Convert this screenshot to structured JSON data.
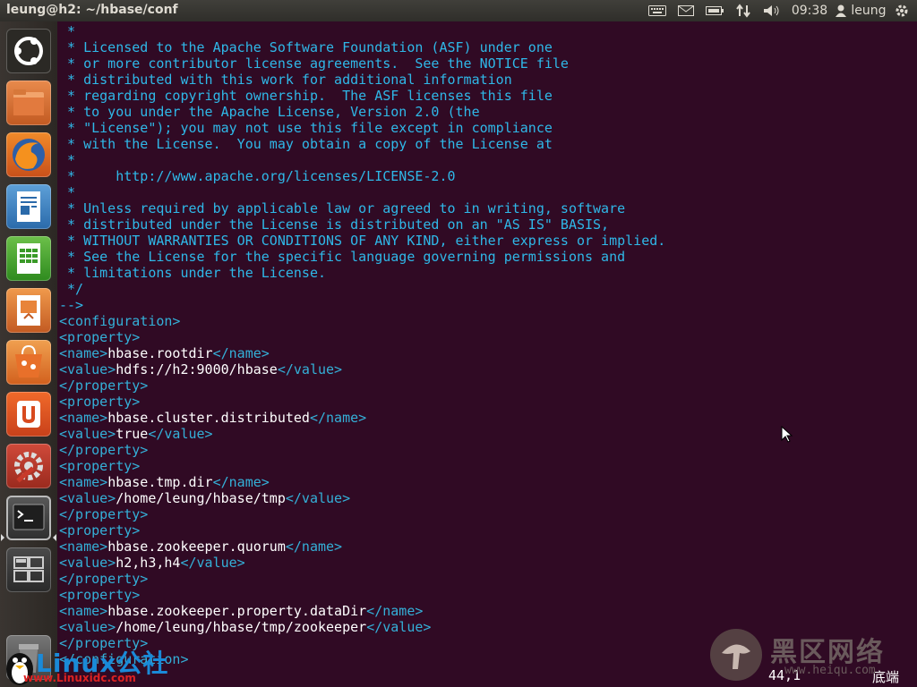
{
  "window_title": "leung@h2: ~/hbase/conf",
  "panel": {
    "clock": "09:38",
    "user": "leung",
    "icons": [
      "keyboard-icon",
      "mail-icon",
      "battery-icon",
      "network-icon",
      "volume-icon",
      "user-icon",
      "gear-icon"
    ]
  },
  "launcher": {
    "items": [
      {
        "name": "ubuntu-dash-icon"
      },
      {
        "name": "files-icon"
      },
      {
        "name": "firefox-icon"
      },
      {
        "name": "writer-icon"
      },
      {
        "name": "calc-icon"
      },
      {
        "name": "impress-icon"
      },
      {
        "name": "software-center-icon"
      },
      {
        "name": "ubuntu-one-icon"
      },
      {
        "name": "system-settings-icon"
      },
      {
        "name": "terminal-icon"
      },
      {
        "name": "workspace-switcher-icon"
      },
      {
        "name": "trash-icon"
      }
    ]
  },
  "terminal": {
    "lines": [
      " *",
      " * Licensed to the Apache Software Foundation (ASF) under one",
      " * or more contributor license agreements.  See the NOTICE file",
      " * distributed with this work for additional information",
      " * regarding copyright ownership.  The ASF licenses this file",
      " * to you under the Apache License, Version 2.0 (the",
      " * \"License\"); you may not use this file except in compliance",
      " * with the License.  You may obtain a copy of the License at",
      " *",
      " *     http://www.apache.org/licenses/LICENSE-2.0",
      " *",
      " * Unless required by applicable law or agreed to in writing, software",
      " * distributed under the License is distributed on an \"AS IS\" BASIS,",
      " * WITHOUT WARRANTIES OR CONDITIONS OF ANY KIND, either express or implied.",
      " * See the License for the specific language governing permissions and",
      " * limitations under the License.",
      " */",
      "-->",
      "<configuration>",
      "<property>",
      "<name>hbase.rootdir</name>",
      "<value>hdfs://h2:9000/hbase</value>",
      "</property>",
      "<property>",
      "<name>hbase.cluster.distributed</name>",
      "<value>true</value>",
      "</property>",
      "<property>",
      "<name>hbase.tmp.dir</name>",
      "<value>/home/leung/hbase/tmp</value>",
      "</property>",
      "<property>",
      "<name>hbase.zookeeper.quorum</name>",
      "<value>h2,h3,h4</value>",
      "</property>",
      "<property>",
      "<name>hbase.zookeeper.property.dataDir</name>",
      "<value>/home/leung/hbase/tmp/zookeeper</value>",
      "</property>",
      "</configuration>"
    ],
    "cursor_position": "44,1",
    "scroll_position": "底端"
  },
  "watermarks": {
    "left_logo": "Linux公社",
    "left_url": "www.Linuxidc.com",
    "right_logo": "黑区网络",
    "right_url": "www.heiqu.com"
  },
  "colors": {
    "terminal_bg": "#300a24",
    "comment": "#2fb8e8",
    "tag": "#34b0d8",
    "text": "#ffffff"
  }
}
